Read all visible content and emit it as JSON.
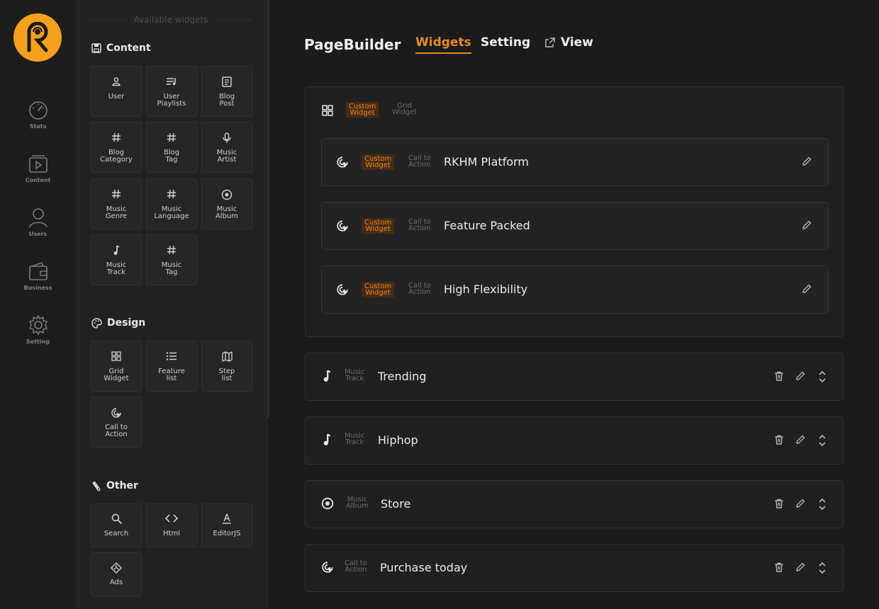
{
  "brand": {
    "accent": "#e38a27",
    "logo_bg": "#f5a11e"
  },
  "rail": [
    {
      "label": "Stats",
      "icon": "gauge-icon"
    },
    {
      "label": "Content",
      "icon": "video-stack-icon"
    },
    {
      "label": "Users",
      "icon": "user-icon"
    },
    {
      "label": "Business",
      "icon": "wallet-icon"
    },
    {
      "label": "Setting",
      "icon": "gear-icon"
    }
  ],
  "panel": {
    "heading": "Available widgets",
    "content": {
      "title": "Content",
      "tiles": [
        {
          "label": "User",
          "icon": "user-icon"
        },
        {
          "label": "User\nPlaylists",
          "icon": "playlist-icon"
        },
        {
          "label": "Blog\nPost",
          "icon": "document-icon"
        },
        {
          "label": "Blog\nCategory",
          "icon": "hash-icon"
        },
        {
          "label": "Blog\nTag",
          "icon": "hash-icon"
        },
        {
          "label": "Music\nArtist",
          "icon": "microphone-icon"
        },
        {
          "label": "Music\nGenre",
          "icon": "hash-icon"
        },
        {
          "label": "Music\nLanguage",
          "icon": "hash-icon"
        },
        {
          "label": "Music\nAlbum",
          "icon": "disc-icon"
        },
        {
          "label": "Music\nTrack",
          "icon": "music-note-icon"
        },
        {
          "label": "Music\nTag",
          "icon": "hash-icon"
        }
      ]
    },
    "design": {
      "title": "Design",
      "tiles": [
        {
          "label": "Grid\nWidget",
          "icon": "grid-icon"
        },
        {
          "label": "Feature\nlist",
          "icon": "list-icon"
        },
        {
          "label": "Step\nlist",
          "icon": "map-icon"
        },
        {
          "label": "Call to\nAction",
          "icon": "cursor-click-icon"
        }
      ]
    },
    "other": {
      "title": "Other",
      "tiles": [
        {
          "label": "Search",
          "icon": "search-icon"
        },
        {
          "label": "Html",
          "icon": "code-icon"
        },
        {
          "label": "EditorJS",
          "icon": "text-icon"
        },
        {
          "label": "Ads",
          "icon": "ad-tag-icon"
        }
      ]
    }
  },
  "header": {
    "title": "PageBuilder",
    "tabs": {
      "widgets": "Widgets",
      "setting": "Setting",
      "view": "View"
    }
  },
  "builder": {
    "grid": {
      "badge_custom": "Custom\nWidget",
      "badge_type": "Grid\nWidget",
      "items": [
        {
          "badge_custom": "Custom\nWidget",
          "badge_type": "Call to\nAction",
          "title": "RKHM Platform"
        },
        {
          "badge_custom": "Custom\nWidget",
          "badge_type": "Call to\nAction",
          "title": "Feature Packed"
        },
        {
          "badge_custom": "Custom\nWidget",
          "badge_type": "Call to\nAction",
          "title": "High Flexibility"
        }
      ]
    },
    "rows": [
      {
        "type": "Music\nTrack",
        "title": "Trending",
        "icon": "music-note-icon"
      },
      {
        "type": "Music\nTrack",
        "title": "Hiphop",
        "icon": "music-note-icon"
      },
      {
        "type": "Music\nAlbum",
        "title": "Store",
        "icon": "disc-icon"
      },
      {
        "type": "Call to\nAction",
        "title": "Purchase today",
        "icon": "cursor-click-icon"
      }
    ]
  }
}
